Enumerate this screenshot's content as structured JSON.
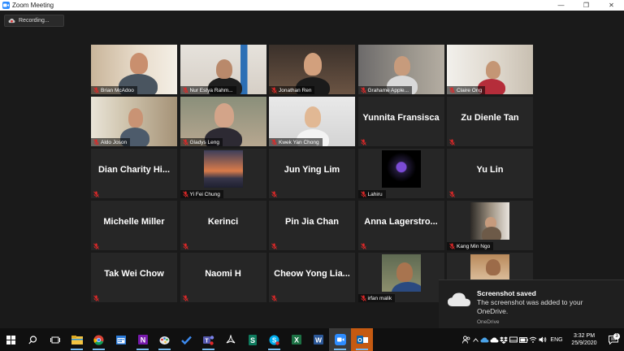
{
  "window": {
    "title": "Zoom Meeting",
    "controls": [
      "—",
      "❐",
      "✕"
    ]
  },
  "recording": {
    "label": "Recording..."
  },
  "participants": [
    {
      "name": "Brian McAdoo",
      "video": true
    },
    {
      "name": "Nur Estya Rahm...",
      "video": true
    },
    {
      "name": "Jonathan Ren",
      "video": true
    },
    {
      "name": "Grahame Apple...",
      "video": true
    },
    {
      "name": "Claire Ong",
      "video": true
    },
    {
      "name": "Aldo Joson",
      "video": true
    },
    {
      "name": "Gladys Leng",
      "video": true
    },
    {
      "name": "Kwek Yan Chong",
      "video": true
    },
    {
      "name": "Yunnita Fransisca",
      "video": false
    },
    {
      "name": "Zu Dienle Tan",
      "video": false
    },
    {
      "name": "Dian Charity Hi...",
      "video": false
    },
    {
      "name": "Yi Fei Chung",
      "video": true
    },
    {
      "name": "Jun Ying Lim",
      "video": false
    },
    {
      "name": "Lahiru",
      "video": true
    },
    {
      "name": "Yu Lin",
      "video": false
    },
    {
      "name": "Michelle Miller",
      "video": false
    },
    {
      "name": "Kerinci",
      "video": false
    },
    {
      "name": "Pin Jia Chan",
      "video": false
    },
    {
      "name": "Anna  Lagerstro...",
      "video": false
    },
    {
      "name": "Kang Min Ngo",
      "video": true
    },
    {
      "name": "Tak Wei Chow",
      "video": false
    },
    {
      "name": "Naomi H",
      "video": false
    },
    {
      "name": "Cheow  Yong  Lia...",
      "video": false
    },
    {
      "name": "irfan malik",
      "video": true
    },
    {
      "name": "",
      "video": true
    }
  ],
  "toast": {
    "title": "Screenshot saved",
    "body": "The screenshot was added to your OneDrive.",
    "source": "OneDrive"
  },
  "taskbar": {
    "apps": [
      "windows-start",
      "search",
      "task-view",
      "file-explorer",
      "chrome",
      "calendar",
      "onenote",
      "paint",
      "todo",
      "teams",
      "acrobat",
      "sway",
      "skype",
      "excel",
      "word",
      "zoom",
      "outlook"
    ],
    "language": "ENG",
    "time": "3:32 PM",
    "date": "25/9/2020",
    "notification_count": "3"
  },
  "colors": {
    "accent": "#2d8cff",
    "mic_muted": "#e02828",
    "tile_bg": "#262626"
  }
}
